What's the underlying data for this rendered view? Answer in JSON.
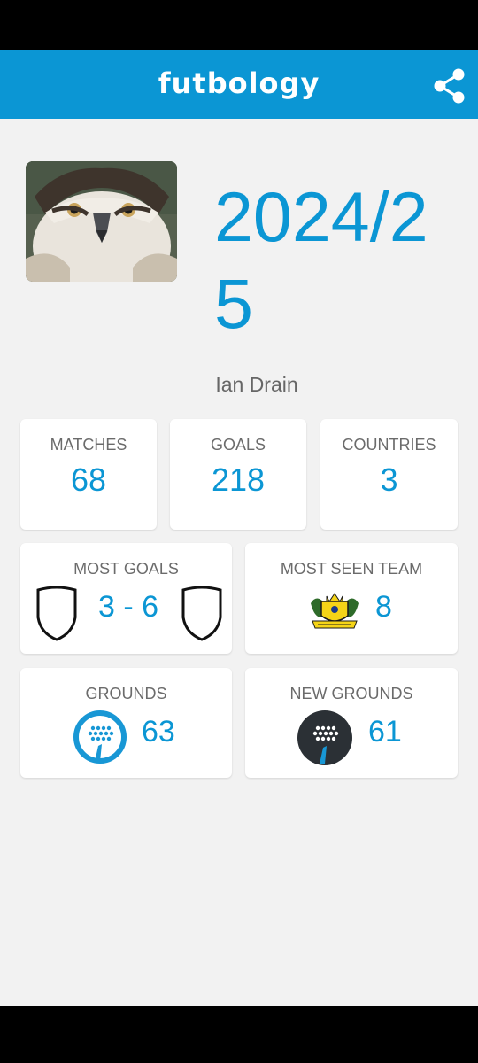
{
  "app": {
    "title": "futbology"
  },
  "profile": {
    "season": "2024/25",
    "name": "Ian Drain"
  },
  "stats": {
    "matches": {
      "label": "MATCHES",
      "value": "68"
    },
    "goals": {
      "label": "GOALS",
      "value": "218"
    },
    "countries": {
      "label": "COUNTRIES",
      "value": "3"
    }
  },
  "most_goals": {
    "label": "MOST GOALS",
    "score": "3 - 6"
  },
  "most_seen_team": {
    "label": "MOST SEEN TEAM",
    "value": "8"
  },
  "grounds": {
    "label": "GROUNDS",
    "value": "63"
  },
  "new_grounds": {
    "label": "NEW GROUNDS",
    "value": "61"
  },
  "colors": {
    "accent": "#0b96d4",
    "background": "#f2f2f2",
    "card": "#ffffff",
    "dark": "#2b3035"
  },
  "icons": {
    "share": "share-icon",
    "ground": "stadium-icon",
    "crest": "team-crest-icon"
  }
}
